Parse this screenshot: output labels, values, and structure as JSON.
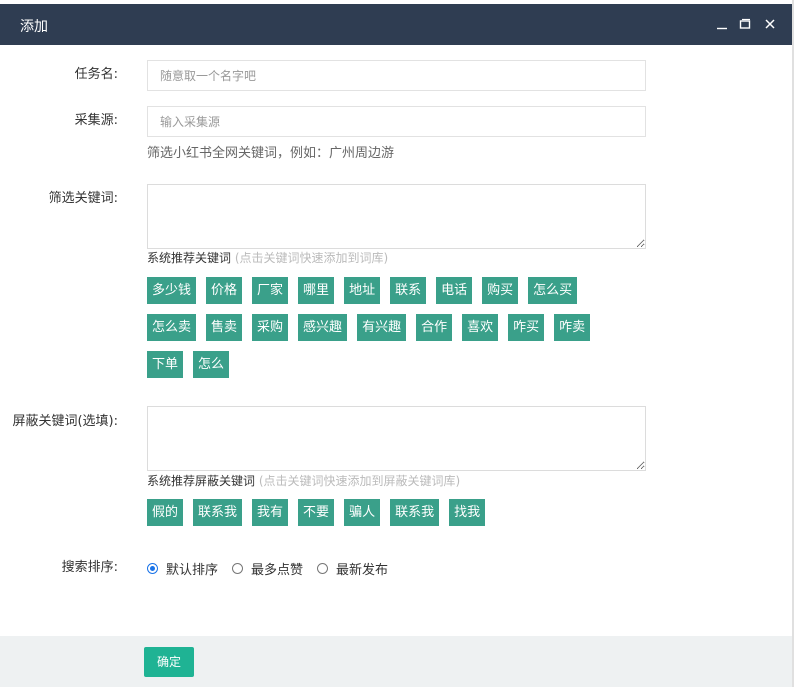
{
  "dialog": {
    "title": "添加"
  },
  "window_controls": {
    "minimize": "minimize-icon",
    "maximize": "maximize-icon",
    "close": "close-icon"
  },
  "form": {
    "task_name": {
      "label": "任务名:",
      "placeholder": "随意取一个名字吧",
      "value": ""
    },
    "source": {
      "label": "采集源:",
      "placeholder": "输入采集源",
      "value": "",
      "help": "筛选小红书全网关键词，例如：广州周边游"
    },
    "filter_keywords": {
      "label": "筛选关键词:",
      "value": "",
      "hint": "系统推荐关键词",
      "hint_sub": "(点击关键词快速添加到词库)",
      "chips": [
        "多少钱",
        "价格",
        "厂家",
        "哪里",
        "地址",
        "联系",
        "电话",
        "购买",
        "怎么买",
        "怎么卖",
        "售卖",
        "采购",
        "感兴趣",
        "有兴趣",
        "合作",
        "喜欢",
        "咋买",
        "咋卖",
        "下单",
        "怎么"
      ]
    },
    "block_keywords": {
      "label": "屏蔽关键词(选填):",
      "value": "",
      "hint": "系统推荐屏蔽关键词",
      "hint_sub": "(点击关键词快速添加到屏蔽关键词库)",
      "chips": [
        "假的",
        "联系我",
        "我有",
        "不要",
        "骗人",
        "联系我",
        "找我"
      ]
    },
    "sort": {
      "label": "搜索排序:",
      "options": [
        "默认排序",
        "最多点赞",
        "最新发布"
      ],
      "selected": 0
    }
  },
  "footer": {
    "confirm_label": "确定"
  },
  "colors": {
    "titlebar": "#2f3d52",
    "chip": "#3aa08a",
    "confirm": "#1fb394",
    "radio_selected": "#1a73e8"
  }
}
